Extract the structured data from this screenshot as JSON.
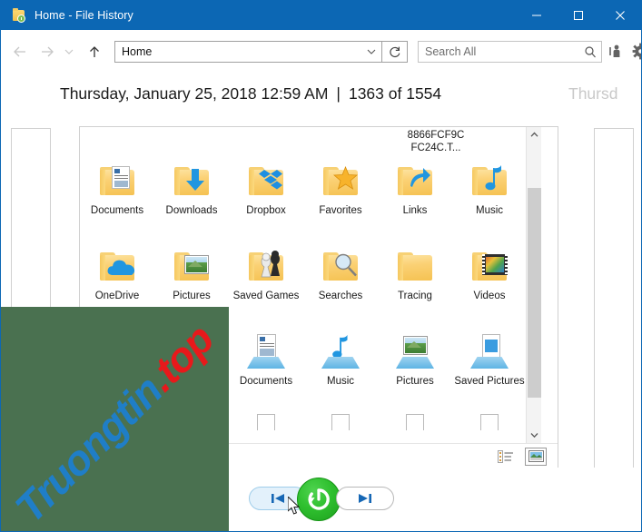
{
  "window": {
    "title": "Home - File History",
    "icon": "folder-clock-icon",
    "accent_color": "#0C67B4",
    "controls": {
      "minimize": "minimize-icon",
      "maximize": "maximize-icon",
      "close": "close-icon"
    }
  },
  "toolbar": {
    "back": "back-arrow-icon",
    "forward": "forward-arrow-icon",
    "recent": "chevron-down-icon",
    "up": "up-arrow-icon",
    "address_value": "Home",
    "address_chevron": "chevron-down-icon",
    "refresh": "refresh-icon",
    "search_placeholder": "Search All",
    "search_value": "",
    "search_icon": "search-icon",
    "help": "help-person-icon",
    "settings": "gear-icon"
  },
  "header": {
    "date": "Thursday, January 25, 2018 12:59 AM",
    "separator": "|",
    "count": "1363 of 1554",
    "ghost_next": "Thursd"
  },
  "file_pane": {
    "clipped_top_label": "8866FCF9C FC24C.T...",
    "rows": [
      {
        "items": [
          {
            "label": "Documents",
            "icon": "folder-documents-icon"
          },
          {
            "label": "Downloads",
            "icon": "folder-downloads-icon"
          },
          {
            "label": "Dropbox",
            "icon": "folder-dropbox-icon"
          },
          {
            "label": "Favorites",
            "icon": "folder-favorites-icon"
          },
          {
            "label": "Links",
            "icon": "folder-links-icon"
          },
          {
            "label": "Music",
            "icon": "folder-music-icon"
          }
        ]
      },
      {
        "items": [
          {
            "label": "OneDrive",
            "icon": "folder-onedrive-icon"
          },
          {
            "label": "Pictures",
            "icon": "folder-pictures-icon"
          },
          {
            "label": "Saved Games",
            "icon": "folder-saved-games-icon"
          },
          {
            "label": "Searches",
            "icon": "folder-searches-icon"
          },
          {
            "label": "Tracing",
            "icon": "folder-plain-icon"
          },
          {
            "label": "Videos",
            "icon": "folder-videos-icon"
          }
        ]
      },
      {
        "items": [
          {
            "label": "",
            "icon": ""
          },
          {
            "label": "",
            "icon": ""
          },
          {
            "label": "Documents",
            "icon": "library-documents-icon"
          },
          {
            "label": "Music",
            "icon": "library-music-icon"
          },
          {
            "label": "Pictures",
            "icon": "library-pictures-icon"
          },
          {
            "label": "Saved Pictures",
            "icon": "library-saved-pictures-icon"
          }
        ]
      }
    ],
    "scrollbar": {
      "up": "scroll-up-icon",
      "down": "scroll-down-icon"
    },
    "view_toggles": [
      {
        "name": "details-view",
        "icon": "details-view-icon",
        "selected": false
      },
      {
        "name": "thumbnail-view",
        "icon": "thumbnail-view-icon",
        "selected": true
      }
    ]
  },
  "bottom_controls": {
    "previous": "previous-version-icon",
    "restore": "restore-icon",
    "next": "next-version-icon"
  },
  "watermark": {
    "part1": "Truongtin",
    "part2": ".top",
    "color1": "#1f7ec7",
    "color2": "#e8191b",
    "background": "#4a7150"
  }
}
